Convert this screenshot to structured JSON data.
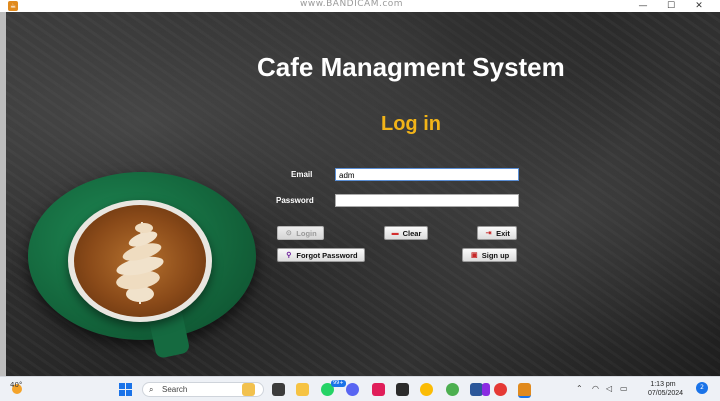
{
  "window": {
    "watermark": "www.BANDICAM.com",
    "minimize_glyph": "—",
    "maximize_glyph": "☐",
    "close_glyph": "✕",
    "app_icon": "java-cup-icon"
  },
  "app": {
    "title": "Cafe Managment System",
    "heading": "Log in",
    "heading_color": "#f2b418"
  },
  "form": {
    "email_label": "Email",
    "email_value": "adm",
    "password_label": "Password",
    "password_value": ""
  },
  "buttons": {
    "login": "Login",
    "clear": "Clear",
    "exit": "Exit",
    "forgot": "Forgot Password",
    "signup": "Sign up"
  },
  "taskbar": {
    "weather_temp": "40°",
    "search_placeholder": "Search",
    "badge": "99+",
    "time": "1:13 pm",
    "date": "07/05/2024",
    "notifications": "2"
  },
  "colors": {
    "accent": "#f2b418",
    "saucer": "#14673d",
    "taskbar_accent": "#1a73e8"
  }
}
